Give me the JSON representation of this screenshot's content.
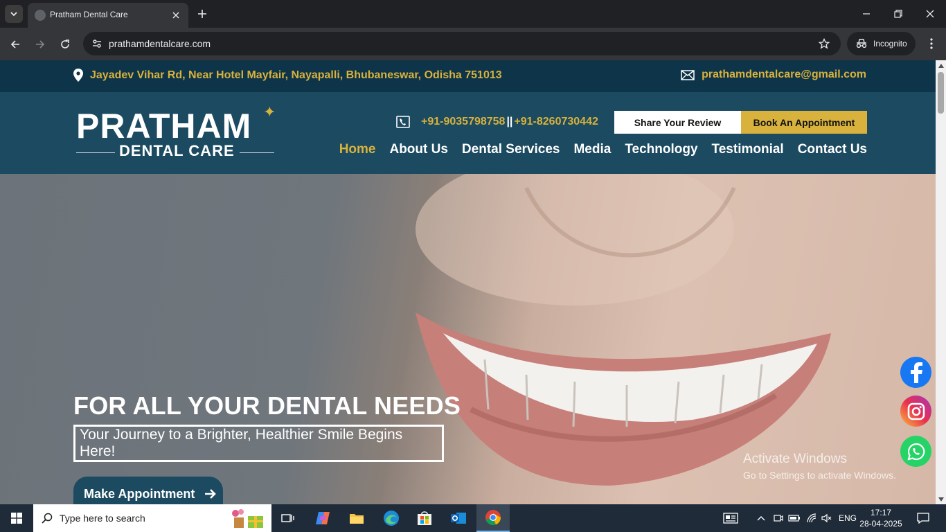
{
  "browser": {
    "tab_title": "Pratham Dental Care",
    "url": "prathamdentalcare.com",
    "incognito_label": "Incognito"
  },
  "site": {
    "address": "Jayadev Vihar Rd, Near Hotel Mayfair, Nayapalli, Bhubaneswar, Odisha 751013",
    "email": "prathamdentalcare@gmail.com",
    "logo": {
      "top": "PRATHAM",
      "bottom": "DENTAL CARE"
    },
    "phone_1": "+91-9035798758",
    "phone_sep": "||",
    "phone_2": "+91-8260730442",
    "review_button": "Share Your Review",
    "book_button": "Book An Appointment",
    "nav": [
      {
        "label": "Home",
        "active": true
      },
      {
        "label": "About Us"
      },
      {
        "label": "Dental Services"
      },
      {
        "label": "Media"
      },
      {
        "label": "Technology"
      },
      {
        "label": "Testimonial"
      },
      {
        "label": "Contact Us"
      }
    ],
    "hero": {
      "title": "FOR ALL YOUR DENTAL NEEDS",
      "subtitle": "Your Journey to a Brighter, Healthier Smile Begins Here!",
      "cta": "Make Appointment"
    },
    "social": [
      "facebook-icon",
      "instagram-icon",
      "whatsapp-icon"
    ]
  },
  "watermark": {
    "line1": "Activate Windows",
    "line2": "Go to Settings to activate Windows."
  },
  "taskbar": {
    "search_placeholder": "Type here to search",
    "language": "ENG",
    "time": "17:17",
    "date": "28-04-2025"
  },
  "colors": {
    "brand_dark": "#0e3449",
    "brand": "#1b4a61",
    "accent_gold": "#d8b23d"
  }
}
